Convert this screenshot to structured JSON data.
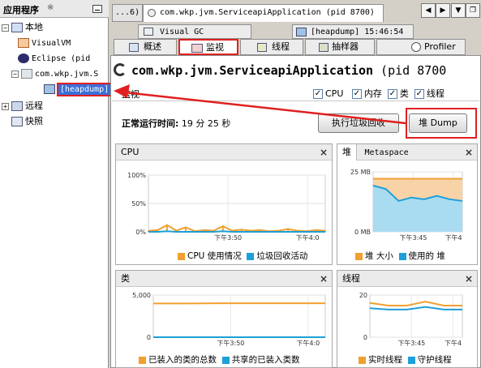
{
  "left_panel": {
    "title": "应用程序",
    "close_mark": "※",
    "items": [
      {
        "label": "本地"
      },
      {
        "label": "VisualVM"
      },
      {
        "label": "Eclipse (pid"
      },
      {
        "label": "com.wkp.jvm.S"
      },
      {
        "label": "[heapdump]"
      },
      {
        "label": "远程"
      },
      {
        "label": "快照"
      }
    ]
  },
  "top_tabs": {
    "overflow": "...6)",
    "app_tab": "com.wkp.jvm.ServiceapiApplication (pid 8700)",
    "visual_gc": "Visual GC",
    "heapdump": "[heapdump] 15:46:54"
  },
  "sub_tabs": [
    "概述",
    "监视",
    "线程",
    "抽样器",
    "Profiler"
  ],
  "app_title": {
    "name": "com.wkp.jvm.ServiceapiApplication",
    "pid": "(pid 8700"
  },
  "monitor": {
    "label": "监视",
    "checks": [
      "CPU",
      "内存",
      "类",
      "线程"
    ],
    "uptime_label": "正常运行时间:",
    "uptime_value": "19 分 25 秒",
    "gc_button": "执行垃圾回收",
    "dump_button": "堆 Dump"
  },
  "panels": {
    "cpu": {
      "title": "CPU",
      "y_ticks": [
        "100%",
        "50%",
        "0%"
      ],
      "x_ticks": [
        "下午3:50",
        "下午4:0"
      ],
      "legend": [
        "CPU 使用情况",
        "垃圾回收活动"
      ]
    },
    "heap": {
      "tab_heap": "堆",
      "tab_meta": "Metaspace",
      "y_ticks": [
        "25 MB",
        "0 MB"
      ],
      "x_ticks": [
        "下午3:45",
        "下午4"
      ],
      "legend": [
        "堆 大小",
        "使用的 堆"
      ]
    },
    "classes": {
      "title": "类",
      "y_ticks": [
        "5,000",
        "0"
      ],
      "x_ticks": [
        "下午3:50",
        "下午4:0"
      ],
      "legend": [
        "已装入的类的总数",
        "共享的已装入类数"
      ]
    },
    "threads": {
      "title": "线程",
      "y_ticks": [
        "20",
        "0"
      ],
      "x_ticks": [
        "下午3:45",
        "下午4"
      ],
      "legend": [
        "实时线程",
        "守护线程"
      ]
    }
  },
  "colors": {
    "orange": "#f0a030",
    "blue": "#1e9fd8",
    "red": "#e02020"
  },
  "chart_data": [
    {
      "type": "line",
      "title": "CPU",
      "series": [
        {
          "name": "CPU 使用情况",
          "values": [
            2,
            3,
            12,
            2,
            8,
            1,
            3,
            2,
            10,
            2,
            4,
            2,
            3,
            1,
            2,
            5,
            2,
            1,
            3,
            2
          ]
        },
        {
          "name": "垃圾回收活动",
          "values": [
            0,
            0,
            1,
            0,
            0,
            0,
            0,
            0,
            1,
            0,
            0,
            0,
            0,
            0,
            0,
            0,
            0,
            0,
            0,
            0
          ]
        }
      ],
      "ylim": [
        0,
        100
      ]
    },
    {
      "type": "area",
      "title": "堆",
      "series": [
        {
          "name": "堆 大小",
          "values": [
            31,
            31,
            31,
            31,
            31,
            31,
            31,
            31
          ]
        },
        {
          "name": "使用的 堆",
          "values": [
            27,
            25,
            18,
            20,
            19,
            21,
            19,
            18
          ]
        }
      ],
      "ylim": [
        0,
        35
      ]
    },
    {
      "type": "line",
      "title": "类",
      "series": [
        {
          "name": "已装入的类的总数",
          "values": [
            6400,
            6400,
            6450,
            6450,
            6450,
            6450
          ]
        },
        {
          "name": "共享的已装入类数",
          "values": [
            0,
            0,
            0,
            0,
            0,
            0
          ]
        }
      ],
      "ylim": [
        0,
        8000
      ]
    },
    {
      "type": "line",
      "title": "线程",
      "series": [
        {
          "name": "实时线程",
          "values": [
            26,
            24,
            24,
            27,
            24,
            24
          ]
        },
        {
          "name": "守护线程",
          "values": [
            22,
            21,
            21,
            23,
            21,
            21
          ]
        }
      ],
      "ylim": [
        0,
        32
      ]
    }
  ]
}
